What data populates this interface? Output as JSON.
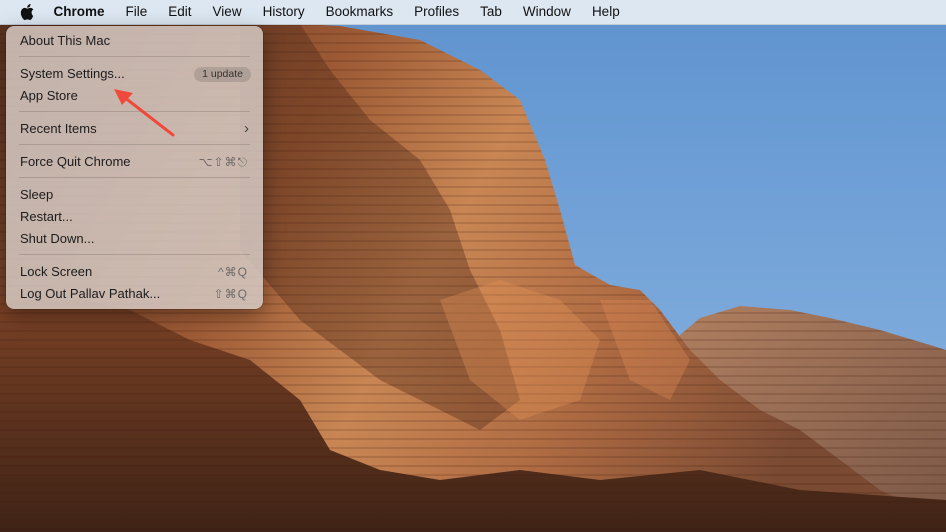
{
  "menubar": {
    "apple_icon": "apple-logo-icon",
    "items": [
      "Chrome",
      "File",
      "Edit",
      "View",
      "History",
      "Bookmarks",
      "Profiles",
      "Tab",
      "Window",
      "Help"
    ]
  },
  "apple_menu": {
    "about": "About This Mac",
    "system_settings": "System Settings...",
    "update_badge": "1 update",
    "app_store": "App Store",
    "recent_items": "Recent Items",
    "recent_items_chevron": "›",
    "force_quit": "Force Quit Chrome",
    "force_quit_shortcut": "⌥⇧⌘⎋",
    "sleep": "Sleep",
    "restart": "Restart...",
    "shut_down": "Shut Down...",
    "lock_screen": "Lock Screen",
    "lock_screen_shortcut": "^⌘Q",
    "log_out": "Log Out Pallav Pathak...",
    "log_out_shortcut": "⇧⌘Q"
  },
  "annotation": {
    "color": "#f0483a"
  }
}
